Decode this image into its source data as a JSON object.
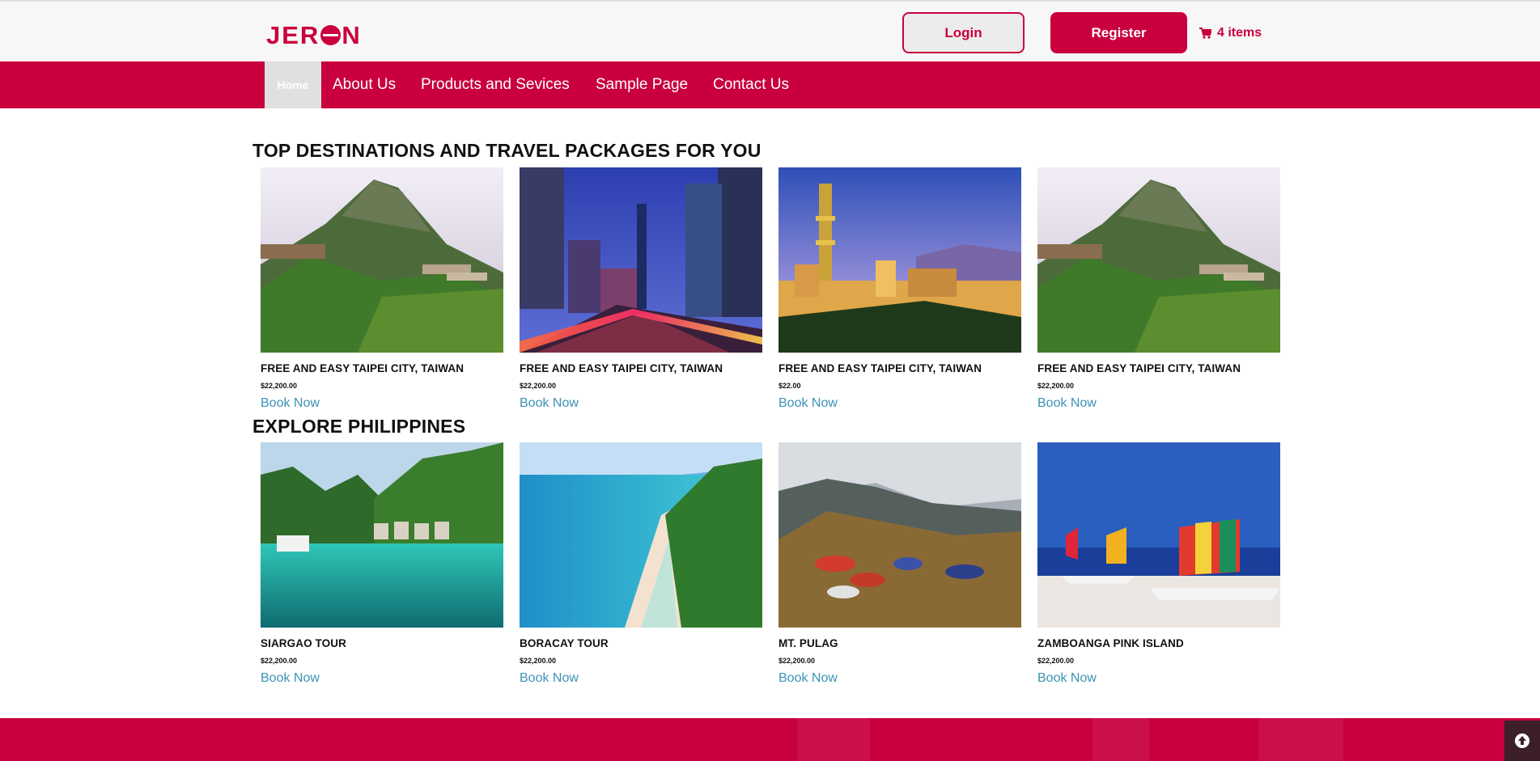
{
  "header": {
    "logo_text_left": "JER",
    "logo_text_right": "N",
    "login_label": "Login",
    "register_label": "Register",
    "cart_label": "4 items",
    "brand_color": "#c9003d"
  },
  "nav": {
    "items": [
      {
        "label": "Home",
        "active": true
      },
      {
        "label": "About Us"
      },
      {
        "label": "Products and Sevices"
      },
      {
        "label": "Sample Page"
      },
      {
        "label": "Contact Us"
      }
    ]
  },
  "sections": [
    {
      "title": "TOP DESTINATIONS AND TRAVEL PACKAGES FOR YOU",
      "cards": [
        {
          "name": "FREE AND EASY TAIPEI CITY, TAIWAN",
          "price": "$22,200.00",
          "cta": "Book Now",
          "image": "mountain-village"
        },
        {
          "name": "FREE AND EASY TAIPEI CITY, TAIWAN",
          "price": "$22,200.00",
          "cta": "Book Now",
          "image": "city-night-street"
        },
        {
          "name": "FREE AND EASY TAIPEI CITY, TAIWAN",
          "price": "$22.00",
          "cta": "Book Now",
          "image": "city-skyline-tower"
        },
        {
          "name": "FREE AND EASY TAIPEI CITY, TAIWAN",
          "price": "$22,200.00",
          "cta": "Book Now",
          "image": "mountain-village"
        }
      ]
    },
    {
      "title": "EXPLORE PHILIPPINES",
      "cards": [
        {
          "name": "SIARGAO TOUR",
          "price": "$22,200.00",
          "cta": "Book Now",
          "image": "lagoon-cottages"
        },
        {
          "name": "BORACAY TOUR",
          "price": "$22,200.00",
          "cta": "Book Now",
          "image": "beach-aerial"
        },
        {
          "name": "MT. PULAG",
          "price": "$22,200.00",
          "cta": "Book Now",
          "image": "mountain-campsite"
        },
        {
          "name": "ZAMBOANGA PINK ISLAND",
          "price": "$22,200.00",
          "cta": "Book Now",
          "image": "beach-sailboats"
        }
      ]
    }
  ],
  "colors": {
    "nav_bg": "#c9003d",
    "link": "#3b93b5",
    "footer_bg": "#c8003e"
  }
}
